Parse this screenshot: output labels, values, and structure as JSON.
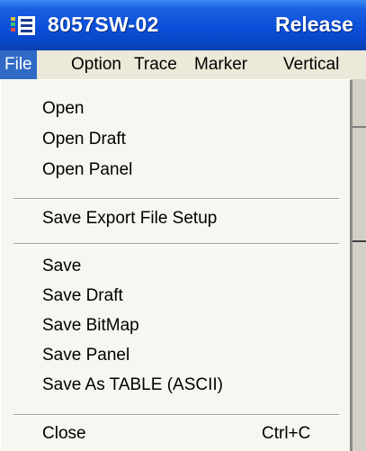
{
  "window": {
    "title": "8057SW-02",
    "title_right": "Release",
    "icon": "app-window-icon"
  },
  "menubar": {
    "items": [
      {
        "label": "File",
        "active": true
      },
      {
        "label": "Option"
      },
      {
        "label": "Trace"
      },
      {
        "label": "Marker"
      },
      {
        "label": "Vertical"
      }
    ]
  },
  "file_menu": {
    "items": [
      {
        "label": "Open"
      },
      {
        "label": "Open Draft"
      },
      {
        "label": "Open Panel"
      },
      {
        "label": "Save Export File Setup"
      },
      {
        "label": "Save"
      },
      {
        "label": "Save Draft"
      },
      {
        "label": "Save BitMap"
      },
      {
        "label": "Save Panel"
      },
      {
        "label": "Save As TABLE (ASCII)"
      },
      {
        "label": "Close",
        "shortcut": "Ctrl+C"
      }
    ]
  },
  "colors": {
    "titlebar": "#0a4fd9",
    "menu_highlight": "#316ac5",
    "menu_bg": "#ece9d8"
  }
}
